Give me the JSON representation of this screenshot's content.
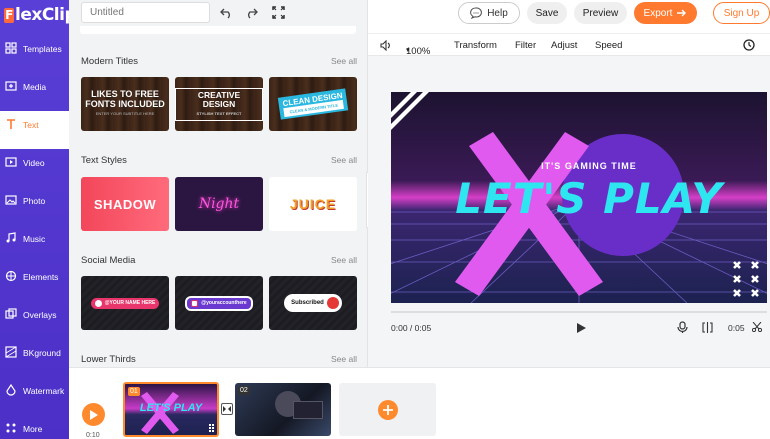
{
  "app": {
    "logo_initial": "F",
    "logo_text": "lexClip"
  },
  "sidebar": {
    "items": [
      {
        "label": "Templates",
        "icon": "templates-icon"
      },
      {
        "label": "Media",
        "icon": "media-icon"
      },
      {
        "label": "Text",
        "icon": "text-icon"
      },
      {
        "label": "Video",
        "icon": "video-icon"
      },
      {
        "label": "Photo",
        "icon": "photo-icon"
      },
      {
        "label": "Music",
        "icon": "music-icon"
      },
      {
        "label": "Elements",
        "icon": "elements-icon"
      },
      {
        "label": "Overlays",
        "icon": "overlays-icon"
      },
      {
        "label": "BKground",
        "icon": "background-icon"
      },
      {
        "label": "Watermark",
        "icon": "watermark-icon"
      },
      {
        "label": "More",
        "icon": "more-icon"
      }
    ],
    "active": "Text"
  },
  "header": {
    "title_placeholder": "Untitled",
    "help_label": "Help",
    "save_label": "Save",
    "preview_label": "Preview",
    "export_label": "Export",
    "signup_label": "Sign Up"
  },
  "panel": {
    "see_all": "See all",
    "sections": [
      {
        "title": "Modern Titles",
        "thumbs": [
          {
            "main": "LIKES TO FREE FONTS INCLUDED",
            "sub": "ENTER YOUR SUBTITLE HERE"
          },
          {
            "main": "CREATIVE DESIGN",
            "sub": "STYLISH TEXT EFFECT"
          },
          {
            "main": "CLEAN DESIGN",
            "sub": "CLEAN & MODERN TITLE"
          }
        ]
      },
      {
        "title": "Text Styles",
        "thumbs": [
          {
            "main": "SHADOW"
          },
          {
            "main": "Night"
          },
          {
            "main": "JUICE"
          }
        ]
      },
      {
        "title": "Social Media",
        "thumbs": [
          {
            "main": "@YOUR NAME HERE"
          },
          {
            "main": "@youraccounthere"
          },
          {
            "main": "Subscribed"
          }
        ]
      },
      {
        "title": "Lower Thirds",
        "thumbs": []
      }
    ]
  },
  "edit_bar": {
    "zoom": "100%",
    "tools": [
      "Transform",
      "Filter",
      "Adjust",
      "Speed"
    ]
  },
  "stage": {
    "subtitle": "IT'S GAMING TIME",
    "title": "LET'S PLAY"
  },
  "player": {
    "time": "0:00 / 0:05",
    "clip_duration": "0:05"
  },
  "timeline": {
    "clips": [
      {
        "number": "01",
        "title": "LET'S PLAY"
      },
      {
        "number": "02"
      }
    ],
    "time_label": "0:10"
  },
  "colors": {
    "brand": "#5a3fd6",
    "accent": "#ff7a2e",
    "pink": "#e05af0",
    "cyan": "#2ee6f0"
  }
}
